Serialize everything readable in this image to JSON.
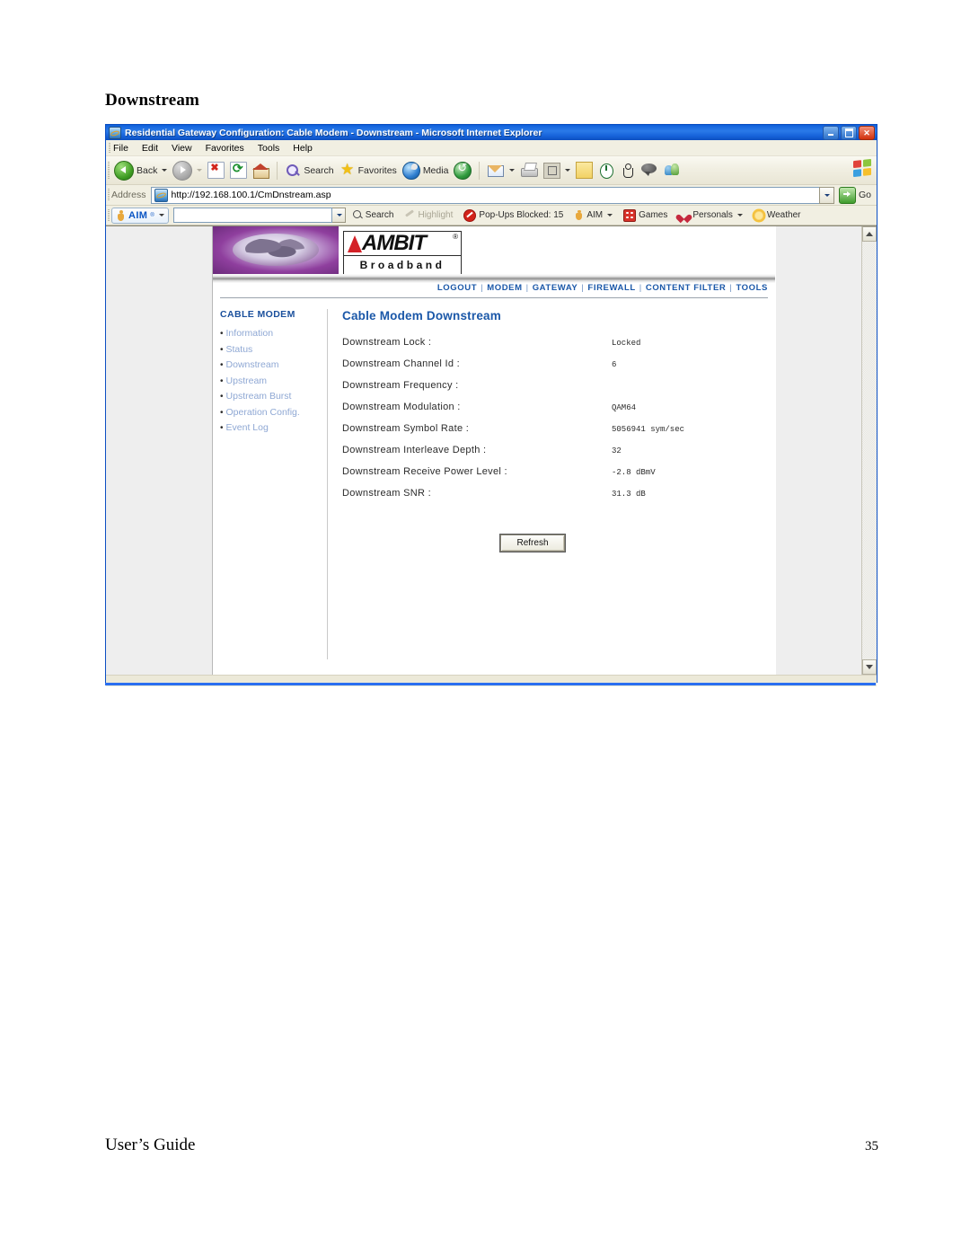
{
  "document": {
    "heading": "Downstream",
    "footer_left": "User’s Guide",
    "footer_page": "35"
  },
  "browser": {
    "title": "Residential Gateway Configuration: Cable Modem - Downstream - Microsoft Internet Explorer",
    "window_controls": {
      "minimize": "Minimize",
      "maximize": "Restore",
      "close": "Close"
    },
    "menus": [
      "File",
      "Edit",
      "View",
      "Favorites",
      "Tools",
      "Help"
    ],
    "toolbar": {
      "back": "Back",
      "forward": "Forward",
      "stop": "Stop",
      "refresh": "Refresh",
      "home": "Home",
      "search": "Search",
      "favorites": "Favorites",
      "media": "Media",
      "history": "History",
      "mail": "Mail",
      "print": "Print",
      "edit": "Edit",
      "notes": "Notes",
      "messenger": "Messenger",
      "person": "Person",
      "discuss": "Discuss",
      "people": "People"
    },
    "address": {
      "label": "Address",
      "url": "http://192.168.100.1/CmDnstream.asp",
      "go": "Go"
    },
    "aim_toolbar": {
      "brand": "AIM",
      "registered": "®",
      "search_value": "",
      "search": "Search",
      "highlight": "Highlight",
      "popups_blocked": "Pop-Ups Blocked: 15",
      "aim": "AIM",
      "games": "Games",
      "personals": "Personals",
      "weather": "Weather"
    }
  },
  "page": {
    "logo": {
      "brand": "AMBIT",
      "registered": "®",
      "tagline": "Broadband"
    },
    "topnav": [
      {
        "label": "LOGOUT"
      },
      {
        "label": "MODEM"
      },
      {
        "label": "GATEWAY"
      },
      {
        "label": "FIREWALL"
      },
      {
        "label": "CONTENT FILTER"
      },
      {
        "label": "TOOLS"
      }
    ],
    "topnav_separator": "|",
    "sidebar": {
      "title": "CABLE MODEM",
      "items": [
        {
          "label": "Information"
        },
        {
          "label": "Status"
        },
        {
          "label": "Downstream"
        },
        {
          "label": "Upstream"
        },
        {
          "label": "Upstream Burst"
        },
        {
          "label": "Operation Config."
        },
        {
          "label": "Event Log"
        }
      ],
      "bullet": "•"
    },
    "main": {
      "title": "Cable Modem Downstream",
      "rows": [
        {
          "label": "Downstream Lock :",
          "value": "Locked"
        },
        {
          "label": "Downstream Channel Id :",
          "value": "6"
        },
        {
          "label": "Downstream Frequency :",
          "value": ""
        },
        {
          "label": "Downstream Modulation :",
          "value": "QAM64"
        },
        {
          "label": "Downstream Symbol Rate :",
          "value": "5056941 sym/sec"
        },
        {
          "label": "Downstream Interleave Depth :",
          "value": "32"
        },
        {
          "label": "Downstream Receive Power Level :",
          "value": "-2.8 dBmV"
        },
        {
          "label": "Downstream SNR :",
          "value": "31.3 dB"
        }
      ],
      "refresh_button": "Refresh"
    }
  },
  "colors": {
    "titlebar_blue": "#1666de",
    "link_blue": "#1a57a8",
    "sidebar_link": "#8fa8d4",
    "accent_rule": "#2a6ff0",
    "logo_red": "#d42127"
  }
}
